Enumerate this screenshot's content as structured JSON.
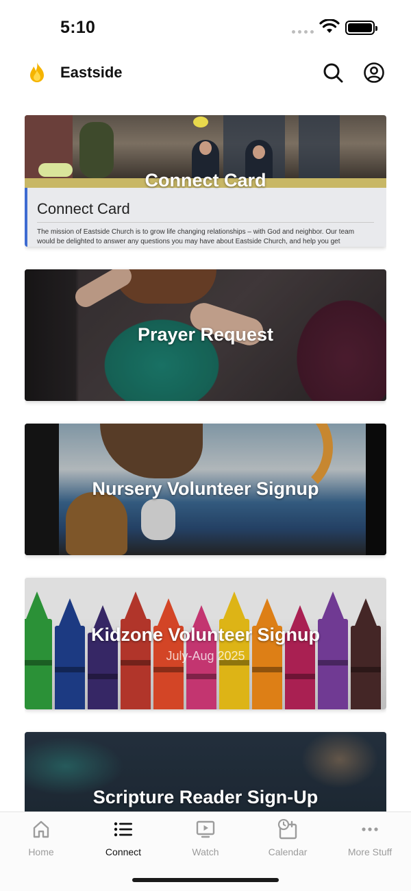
{
  "status_bar": {
    "time": "5:10"
  },
  "header": {
    "title": "Eastside"
  },
  "cards": [
    {
      "title": "Connect Card",
      "doc_title": "Connect Card",
      "doc_text": "The mission of Eastside Church is to grow life changing relationships – with God and neighbor. Our team would be delighted to answer any questions you may have about Eastside Church, and help you get connected to new"
    },
    {
      "title": "Prayer Request"
    },
    {
      "title": "Nursery Volunteer Signup"
    },
    {
      "title": "Kidzone Volunteer Signup",
      "subtitle": "July-Aug 2025"
    },
    {
      "title": "Scripture Reader Sign-Up"
    }
  ],
  "tabs": [
    {
      "label": "Home",
      "icon": "home-icon",
      "active": false
    },
    {
      "label": "Connect",
      "icon": "list-icon",
      "active": true
    },
    {
      "label": "Watch",
      "icon": "play-screen-icon",
      "active": false
    },
    {
      "label": "Calendar",
      "icon": "calendar-clock-icon",
      "active": false
    },
    {
      "label": "More Stuff",
      "icon": "more-dots-icon",
      "active": false
    }
  ],
  "colors": {
    "accent_flame": "#f5b400",
    "active_tab": "#111111",
    "inactive_tab": "#9c9c9c"
  }
}
